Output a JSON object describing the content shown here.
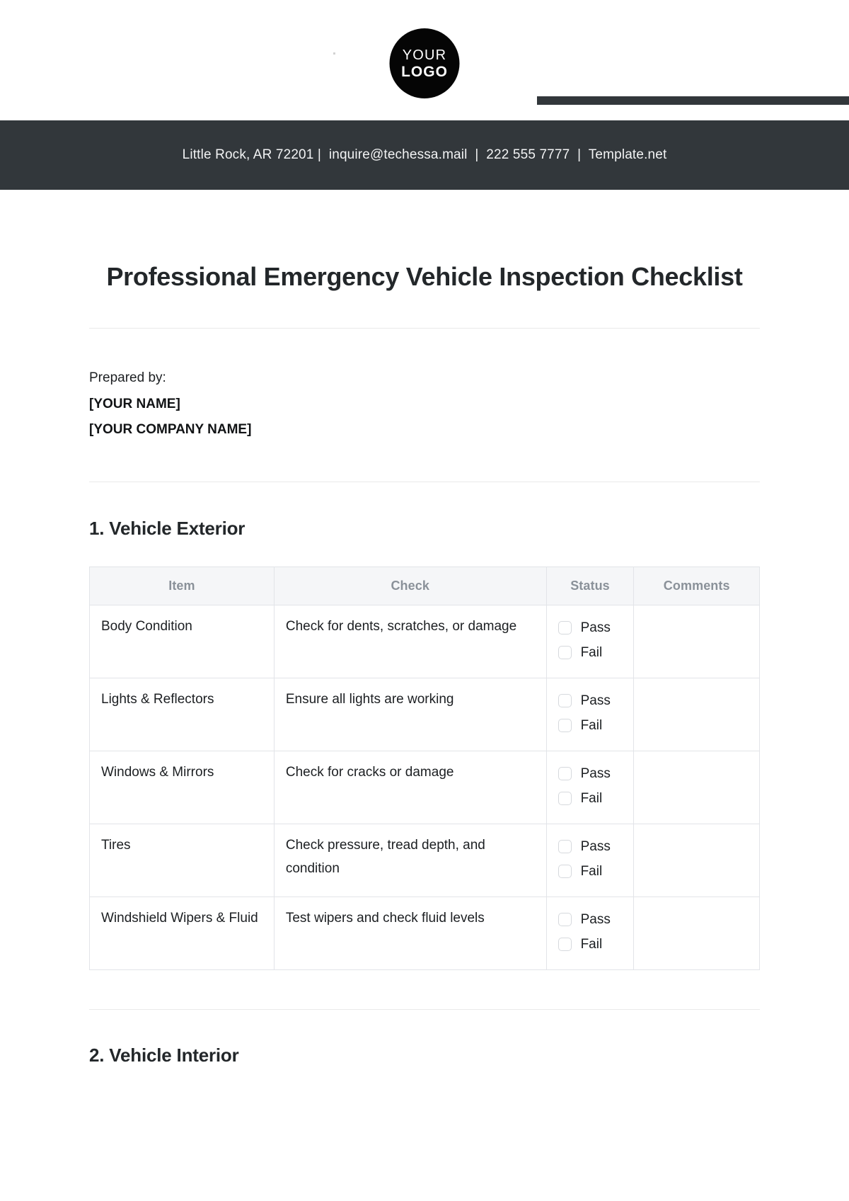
{
  "logo": {
    "top_text": "YOUR",
    "bottom_text": "LOGO"
  },
  "contact_bar": {
    "text": "Little Rock, AR 72201 |  inquire@techessa.mail  |  222 555 7777  |  Template.net",
    "background_color": "#32373b",
    "text_color": "#f2f3f4"
  },
  "document": {
    "title": "Professional Emergency Vehicle Inspection Checklist"
  },
  "prepared_by": {
    "label": "Prepared by:",
    "name": "[YOUR NAME]",
    "company": "[YOUR COMPANY NAME]"
  },
  "sections": [
    {
      "heading": "1. Vehicle Exterior",
      "table": {
        "columns": [
          "Item",
          "Check",
          "Status",
          "Comments"
        ],
        "status_options": [
          "Pass",
          "Fail"
        ],
        "rows": [
          {
            "item": "Body Condition",
            "check": "Check for dents, scratches, or damage",
            "comments": ""
          },
          {
            "item": "Lights & Reflectors",
            "check": "Ensure all lights are working",
            "comments": ""
          },
          {
            "item": "Windows & Mirrors",
            "check": "Check for cracks or damage",
            "comments": ""
          },
          {
            "item": "Tires",
            "check": "Check pressure, tread depth, and condition",
            "comments": ""
          },
          {
            "item": "Windshield Wipers & Fluid",
            "check": "Test wipers and check fluid levels",
            "comments": ""
          }
        ]
      }
    },
    {
      "heading": "2. Vehicle Interior"
    }
  ]
}
